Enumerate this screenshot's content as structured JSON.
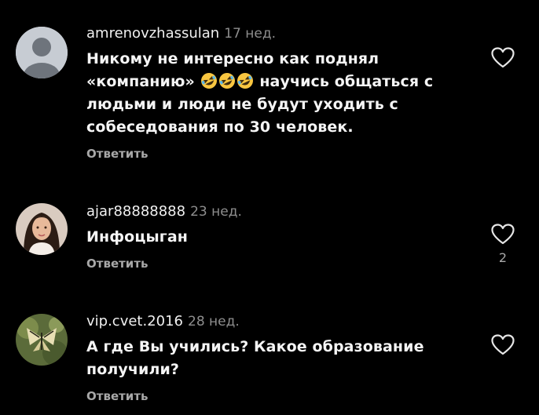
{
  "comments": [
    {
      "username": "amrenovzhassulan",
      "time": "17 нед.",
      "text_before": "Никому не интересно как поднял «компанию»",
      "emojis": [
        "rolling-on-floor-laughing",
        "rolling-on-floor-laughing",
        "rolling-on-floor-laughing"
      ],
      "text_after": " научись общаться с людьми и люди не будут уходить с собеседования по 30 человек.",
      "reply_label": "Ответить",
      "avatar_icon": "default-user-avatar",
      "like_icon": "heart-outline",
      "like_count": ""
    },
    {
      "username": "ajar88888888",
      "time": "23 нед.",
      "text_before": "Инфоцыган",
      "reply_label": "Ответить",
      "avatar_icon": "profile-photo-woman",
      "like_icon": "heart-outline",
      "like_count": "2"
    },
    {
      "username": "vip.cvet.2016",
      "time": "28 нед.",
      "text_before": "А где Вы учились? Какое образование получили?",
      "reply_label": "Ответить",
      "avatar_icon": "profile-photo-butterfly",
      "like_icon": "heart-outline",
      "like_count": ""
    }
  ],
  "colors": {
    "background": "#000000",
    "text": "#f5f5f5",
    "secondary": "#8e8e8e",
    "reply": "#a8a8a8",
    "emoji_yellow": "#f9c640"
  }
}
